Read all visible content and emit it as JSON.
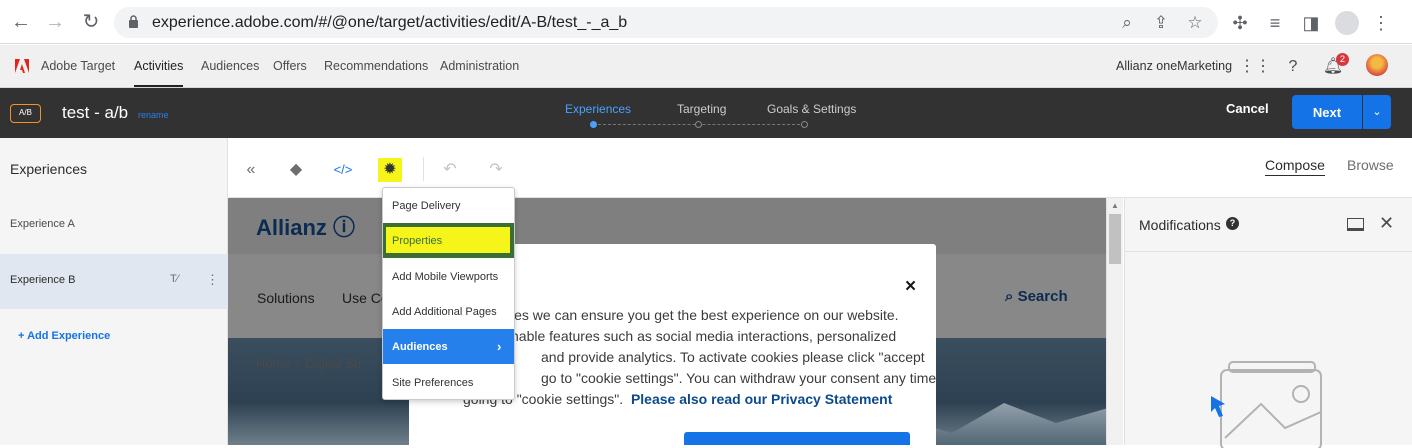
{
  "browser": {
    "url": "experience.adobe.com/#/@one/target/activities/edit/A-B/test_-_a_b"
  },
  "top_nav": {
    "brand": "Adobe Target",
    "items": [
      "Activities",
      "Audiences",
      "Offers",
      "Recommendations",
      "Administration"
    ],
    "active": "Activities",
    "org": "Allianz oneMarketing",
    "notification_count": "2"
  },
  "activity": {
    "type_badge": "A/B",
    "name": "test - a/b",
    "rename": "rename",
    "steps": [
      "Experiences",
      "Targeting",
      "Goals & Settings"
    ],
    "active_step": "Experiences",
    "cancel": "Cancel",
    "next": "Next"
  },
  "experiences": {
    "title": "Experiences",
    "items": [
      "Experience A",
      "Experience B"
    ],
    "selected": "Experience B",
    "add": "+ Add Experience"
  },
  "toolbar": {
    "compose": "Compose",
    "browse": "Browse"
  },
  "menu": {
    "items": [
      "Page Delivery",
      "Properties",
      "Add Mobile Viewports",
      "Add Additional Pages",
      "Audiences",
      "Site Preferences"
    ],
    "highlighted": "Properties",
    "active": "Audiences"
  },
  "preview": {
    "logo": "Allianz ⓘ",
    "nav": [
      "Solutions",
      "Use Co"
    ],
    "search": "Search",
    "breadcrumb": "Home  >  Digital Sh",
    "cookie": {
      "close": "×",
      "lines": [
        "ies we can ensure you get the best experience on our website.",
        "nable features such as social media interactions, personalized",
        "and provide analytics. To activate cookies please click \"accept",
        "go to \"cookie settings\". You can withdraw your consent any time",
        "going to \"cookie settings\"."
      ],
      "link": "Please also read our Privacy Statement"
    }
  },
  "modifications": {
    "title": "Modifications"
  }
}
